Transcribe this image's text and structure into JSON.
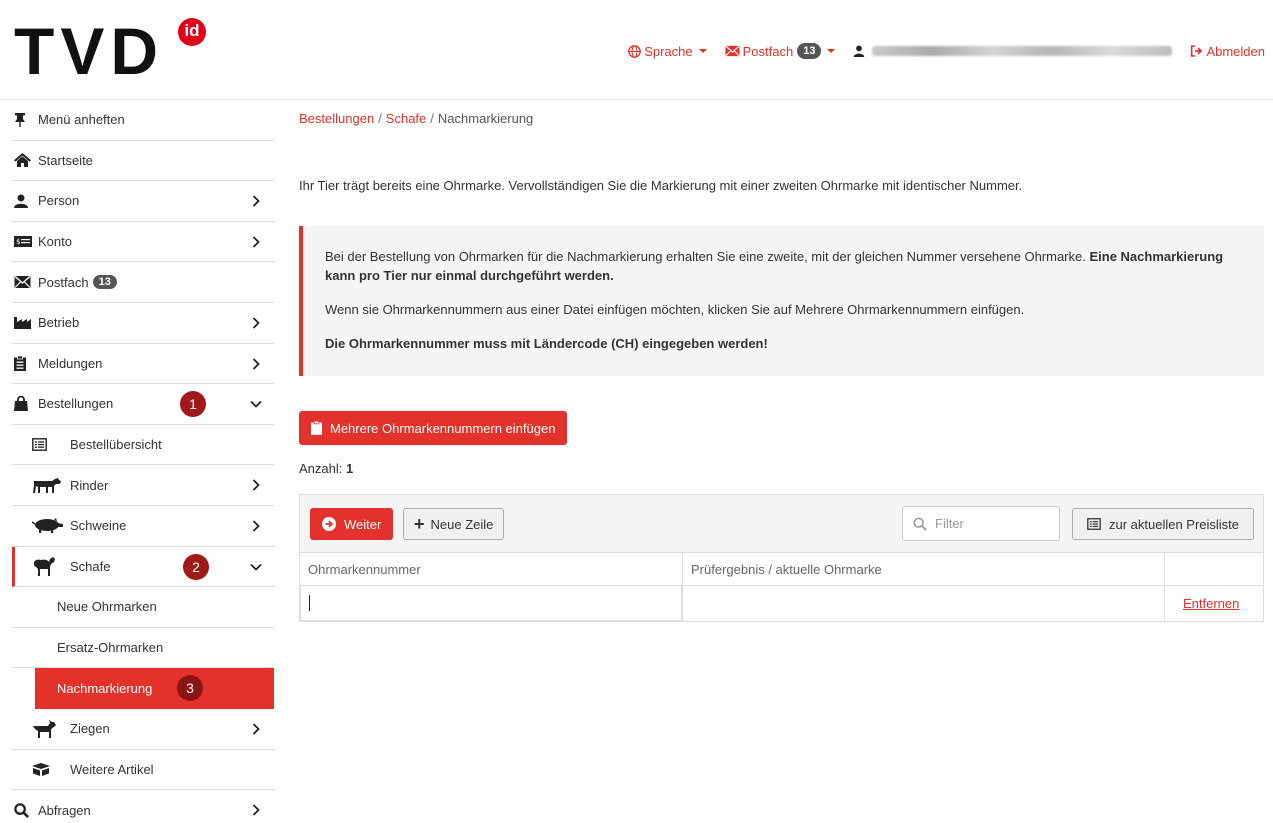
{
  "logo": {
    "text": "TVD",
    "badge": "id"
  },
  "topbar": {
    "language": "Sprache",
    "mailbox": "Postfach",
    "mailbox_count": "13",
    "logout": "Abmelden"
  },
  "sidebar": {
    "items": [
      {
        "label": "Menü anheften",
        "icon": "pin-icon"
      },
      {
        "label": "Startseite",
        "icon": "home-icon"
      },
      {
        "label": "Person",
        "icon": "user-icon"
      },
      {
        "label": "Konto",
        "icon": "money-icon"
      },
      {
        "label": "Postfach",
        "icon": "envelope-icon",
        "badge": "13"
      },
      {
        "label": "Betrieb",
        "icon": "factory-icon"
      },
      {
        "label": "Meldungen",
        "icon": "clipboard-icon"
      },
      {
        "label": "Bestellungen",
        "icon": "shopping-bag-icon",
        "step": "1"
      },
      {
        "label": "Bestellübersicht",
        "icon": "list-icon"
      },
      {
        "label": "Rinder",
        "icon": "cow-icon"
      },
      {
        "label": "Schweine",
        "icon": "pig-icon"
      },
      {
        "label": "Schafe",
        "icon": "sheep-icon",
        "step": "2"
      },
      {
        "label": "Neue Ohrmarken"
      },
      {
        "label": "Ersatz-Ohrmarken"
      },
      {
        "label": "Nachmarkierung",
        "step": "3"
      },
      {
        "label": "Ziegen",
        "icon": "goat-icon"
      },
      {
        "label": "Weitere Artikel",
        "icon": "boxes-icon"
      },
      {
        "label": "Abfragen",
        "icon": "search-icon"
      }
    ]
  },
  "breadcrumb": {
    "items": [
      "Bestellungen",
      "Schafe",
      "Nachmarkierung"
    ],
    "separator": "/"
  },
  "intro": "Ihr Tier trägt bereits eine Ohrmarke. Vervollständigen Sie die Markierung mit einer zweiten Ohrmarke mit identischer Nummer.",
  "callout": {
    "p1_normal": "Bei der Bestellung von Ohrmarken für die Nachmarkierung erhalten Sie eine zweite, mit der gleichen Nummer versehene Ohrmarke. ",
    "p1_bold": "Eine Nachmarkierung kann pro Tier nur einmal durchgeführt werden.",
    "p2": "Wenn sie Ohrmarkennummern aus einer Datei einfügen möchten, klicken Sie auf Mehrere Ohrmarkennummern einfügen.",
    "p3": "Die Ohrmarkennummer muss mit Ländercode (CH) eingegeben werden!"
  },
  "multi_button": "Mehrere Ohrmarkennummern einfügen",
  "count": {
    "label": "Anzahl:",
    "value": "1"
  },
  "toolbar": {
    "next": "Weiter",
    "new_row": "Neue Zeile",
    "filter_placeholder": "Filter",
    "pricelist": "zur aktuellen Preisliste"
  },
  "table": {
    "headers": [
      "Ohrmarkennummer",
      "Prüfergebnis / aktuelle Ohrmarke",
      ""
    ],
    "rows": [
      {
        "number": "",
        "result": "",
        "action": "Entfernen"
      }
    ]
  },
  "colors": {
    "accent": "#e3312b",
    "step": "#a11a1a",
    "badge": "#555555"
  }
}
